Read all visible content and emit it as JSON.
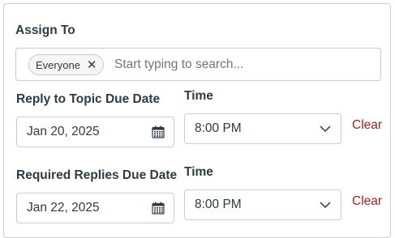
{
  "assign": {
    "label": "Assign To",
    "chips": [
      {
        "label": "Everyone",
        "remove_glyph": "✕"
      }
    ],
    "search_placeholder": "Start typing to search..."
  },
  "rows": [
    {
      "date_label": "Reply to Topic Due Date",
      "time_label": "Time",
      "date_value": "Jan 20, 2025",
      "time_value": "8:00 PM",
      "clear_label": "Clear"
    },
    {
      "date_label": "Required Replies Due Date",
      "time_label": "Time",
      "date_value": "Jan 22, 2025",
      "time_value": "8:00 PM",
      "clear_label": "Clear"
    }
  ],
  "icons": {
    "calendar": "calendar-icon",
    "chevron": "chevron-down-icon",
    "remove": "close-icon"
  },
  "colors": {
    "text": "#2d3b45",
    "border": "#c7cdd1",
    "clear_link": "#98231b",
    "placeholder": "#6b7780"
  }
}
